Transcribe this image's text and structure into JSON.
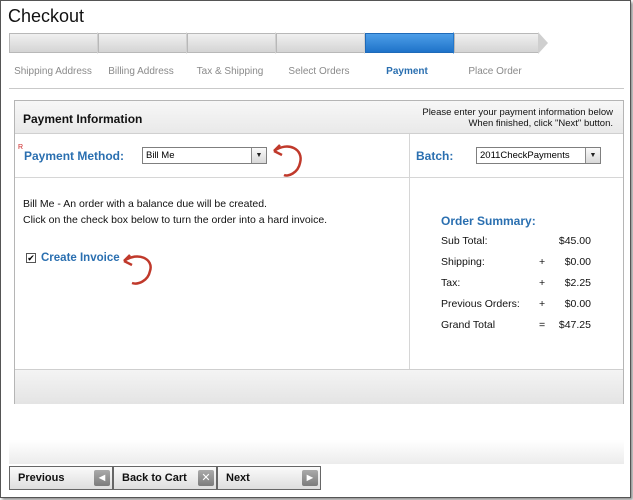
{
  "title": "Checkout",
  "steps": [
    {
      "label": "Shipping Address",
      "active": false
    },
    {
      "label": "Billing Address",
      "active": false
    },
    {
      "label": "Tax & Shipping",
      "active": false
    },
    {
      "label": "Select Orders",
      "active": false
    },
    {
      "label": "Payment",
      "active": true
    },
    {
      "label": "Place Order",
      "active": false
    }
  ],
  "panel": {
    "title": "Payment Information",
    "help_line1": "Please enter your payment information below",
    "help_line2": "When finished, click \"Next\" button."
  },
  "payment_method": {
    "required_mark": "R",
    "label": "Payment Method:",
    "value": "Bill Me"
  },
  "batch": {
    "label": "Batch:",
    "value": "2011CheckPayments"
  },
  "description": {
    "line1": "Bill Me - An order with a balance due will be created.",
    "line2": "Click on the check box below to turn the order into a hard invoice."
  },
  "create_invoice": {
    "label": "Create Invoice",
    "checked": true,
    "check_glyph": "✔"
  },
  "summary": {
    "title": "Order Summary:",
    "rows": [
      {
        "label": "Sub Total:",
        "op": "",
        "amount": "$45.00"
      },
      {
        "label": "Shipping:",
        "op": "+",
        "amount": "$0.00"
      },
      {
        "label": "Tax:",
        "op": "+",
        "amount": "$2.25"
      },
      {
        "label": "Previous Orders:",
        "op": "+",
        "amount": "$0.00"
      },
      {
        "label": "Grand Total",
        "op": "=",
        "amount": "$47.25"
      }
    ]
  },
  "nav": {
    "previous": "Previous",
    "back_to_cart": "Back to Cart",
    "next": "Next",
    "previous_icon": "◄",
    "back_icon": "✕",
    "next_icon": "►"
  },
  "colors": {
    "accent": "#2a6fb0",
    "active_step": "#1f73c9",
    "annotation_red": "#c0392b"
  }
}
